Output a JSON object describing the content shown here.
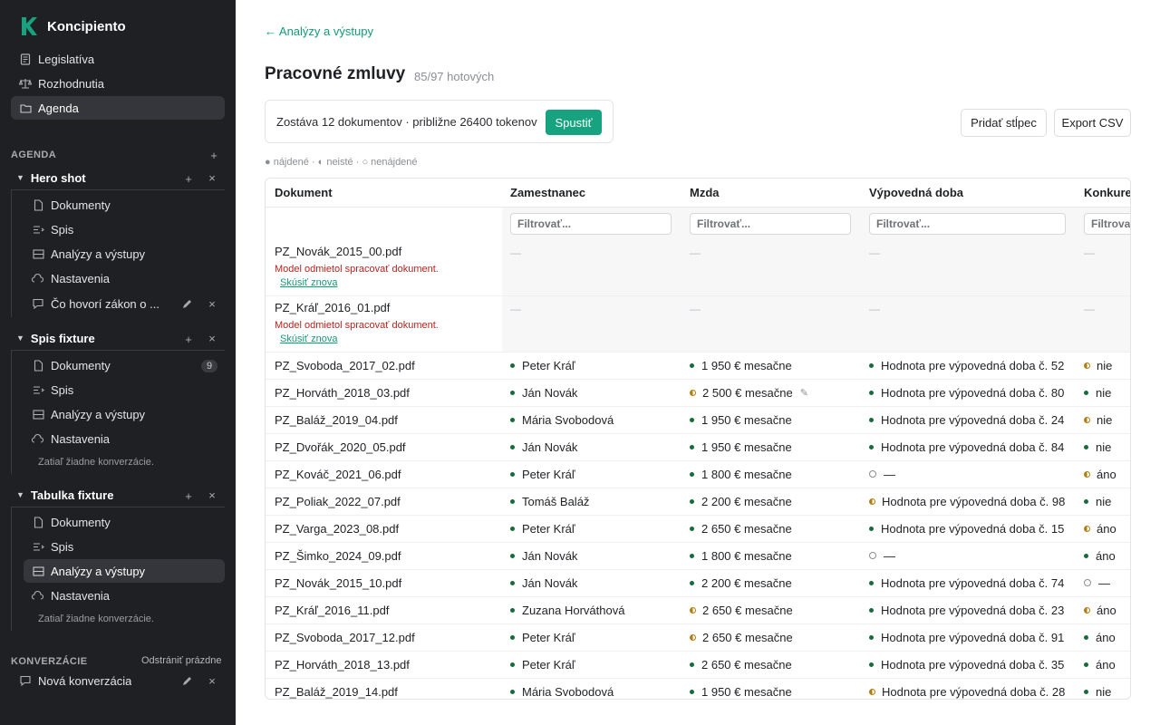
{
  "brand": {
    "name": "Koncipiento",
    "accent": "#17a37f"
  },
  "sidebar": {
    "nav": [
      {
        "label": "Legislatíva",
        "icon": "document-icon"
      },
      {
        "label": "Rozhodnutia",
        "icon": "scales-icon"
      },
      {
        "label": "Agenda",
        "icon": "folder-icon",
        "active": true
      }
    ],
    "agenda_label": "AGENDA",
    "add_symbol": "+",
    "close_symbol": "×",
    "groups": [
      {
        "title": "Hero shot",
        "items": [
          "Dokumenty",
          "Spis",
          "Analýzy a výstupy",
          "Nastavenia"
        ],
        "conversation": "Čo hovorí zákon o ..."
      },
      {
        "title": "Spis fixture",
        "items": [
          "Dokumenty",
          "Spis",
          "Analýzy a výstupy",
          "Nastavenia"
        ],
        "doc_badge": "9",
        "note": "Zatiaľ žiadne konverzácie."
      },
      {
        "title": "Tabulka fixture",
        "items": [
          "Dokumenty",
          "Spis",
          "Analýzy a výstupy",
          "Nastavenia"
        ],
        "note": "Zatiaľ žiadne konverzácie."
      }
    ],
    "conversations_label": "KONVERZÁCIE",
    "remove_empty": "Odstrániť prázdne",
    "new_conversation": "Nová konverzácia"
  },
  "main": {
    "back_link": "← Analýzy a výstupy",
    "title": "Pracovné zmluvy",
    "count": "85/97 hotových",
    "run_text": "Zostáva 12 dokumentov · približne 26400 tokenov",
    "run_button": "Spustiť",
    "add_column": "Pridať stĺpec",
    "export_csv": "Export CSV",
    "legend": "● nájdené · ◐ neisté · ○ nenájdené"
  },
  "table": {
    "columns": [
      "Dokument",
      "Zamestnanec",
      "Mzda",
      "Výpovedná doba",
      "Konkurenčná"
    ],
    "filter_placeholder": "Filtrovať...",
    "error_message": "Model odmietol spracovať dokument.",
    "retry_label": "Skúsiť znova",
    "empty_dash": "—",
    "error_rows": [
      "PZ_Novák_2015_00.pdf",
      "PZ_Kráľ_2016_01.pdf"
    ],
    "rows": [
      {
        "doc": "PZ_Svoboda_2017_02.pdf",
        "emp": "Peter Kráľ",
        "emp_s": "found",
        "wage": "1 950 € mesačne",
        "wage_s": "found",
        "notice": "Hodnota pre výpovedná doba č. 52",
        "notice_s": "found",
        "comp": "nie",
        "comp_s": "unsure"
      },
      {
        "doc": "PZ_Horváth_2018_03.pdf",
        "emp": "Ján Novák",
        "emp_s": "found",
        "wage": "2 500 € mesačne",
        "wage_s": "unsure",
        "wage_edit": true,
        "notice": "Hodnota pre výpovedná doba č. 80",
        "notice_s": "found",
        "comp": "nie",
        "comp_s": "found"
      },
      {
        "doc": "PZ_Baláž_2019_04.pdf",
        "emp": "Mária Svobodová",
        "emp_s": "found",
        "wage": "1 950 € mesačne",
        "wage_s": "found",
        "notice": "Hodnota pre výpovedná doba č. 24",
        "notice_s": "found",
        "comp": "nie",
        "comp_s": "unsure"
      },
      {
        "doc": "PZ_Dvořák_2020_05.pdf",
        "emp": "Ján Novák",
        "emp_s": "found",
        "wage": "1 950 € mesačne",
        "wage_s": "found",
        "notice": "Hodnota pre výpovedná doba č. 84",
        "notice_s": "found",
        "comp": "nie",
        "comp_s": "found"
      },
      {
        "doc": "PZ_Kováč_2021_06.pdf",
        "emp": "Peter Kráľ",
        "emp_s": "found",
        "wage": "1 800 € mesačne",
        "wage_s": "found",
        "notice": "—",
        "notice_s": "missing",
        "comp": "áno",
        "comp_s": "unsure"
      },
      {
        "doc": "PZ_Poliak_2022_07.pdf",
        "emp": "Tomáš Baláž",
        "emp_s": "found",
        "wage": "2 200 € mesačne",
        "wage_s": "found",
        "notice": "Hodnota pre výpovedná doba č. 98",
        "notice_s": "unsure",
        "comp": "nie",
        "comp_s": "found"
      },
      {
        "doc": "PZ_Varga_2023_08.pdf",
        "emp": "Peter Kráľ",
        "emp_s": "found",
        "wage": "2 650 € mesačne",
        "wage_s": "found",
        "notice": "Hodnota pre výpovedná doba č. 15",
        "notice_s": "found",
        "comp": "áno",
        "comp_s": "unsure"
      },
      {
        "doc": "PZ_Šimko_2024_09.pdf",
        "emp": "Ján Novák",
        "emp_s": "found",
        "wage": "1 800 € mesačne",
        "wage_s": "found",
        "notice": "—",
        "notice_s": "missing",
        "comp": "áno",
        "comp_s": "found"
      },
      {
        "doc": "PZ_Novák_2015_10.pdf",
        "emp": "Ján Novák",
        "emp_s": "found",
        "wage": "2 200 € mesačne",
        "wage_s": "found",
        "notice": "Hodnota pre výpovedná doba č. 74",
        "notice_s": "found",
        "comp": "—",
        "comp_s": "missing"
      },
      {
        "doc": "PZ_Kráľ_2016_11.pdf",
        "emp": "Zuzana Horváthová",
        "emp_s": "found",
        "wage": "2 650 € mesačne",
        "wage_s": "unsure",
        "notice": "Hodnota pre výpovedná doba č. 23",
        "notice_s": "found",
        "comp": "áno",
        "comp_s": "unsure"
      },
      {
        "doc": "PZ_Svoboda_2017_12.pdf",
        "emp": "Peter Kráľ",
        "emp_s": "found",
        "wage": "2 650 € mesačne",
        "wage_s": "unsure",
        "notice": "Hodnota pre výpovedná doba č. 91",
        "notice_s": "found",
        "comp": "áno",
        "comp_s": "found"
      },
      {
        "doc": "PZ_Horváth_2018_13.pdf",
        "emp": "Peter Kráľ",
        "emp_s": "found",
        "wage": "2 650 € mesačne",
        "wage_s": "found",
        "notice": "Hodnota pre výpovedná doba č. 35",
        "notice_s": "found",
        "comp": "áno",
        "comp_s": "found"
      },
      {
        "doc": "PZ_Baláž_2019_14.pdf",
        "emp": "Mária Svobodová",
        "emp_s": "found",
        "wage": "1 950 € mesačne",
        "wage_s": "found",
        "notice": "Hodnota pre výpovedná doba č. 28",
        "notice_s": "unsure",
        "comp": "nie",
        "comp_s": "found"
      }
    ]
  }
}
